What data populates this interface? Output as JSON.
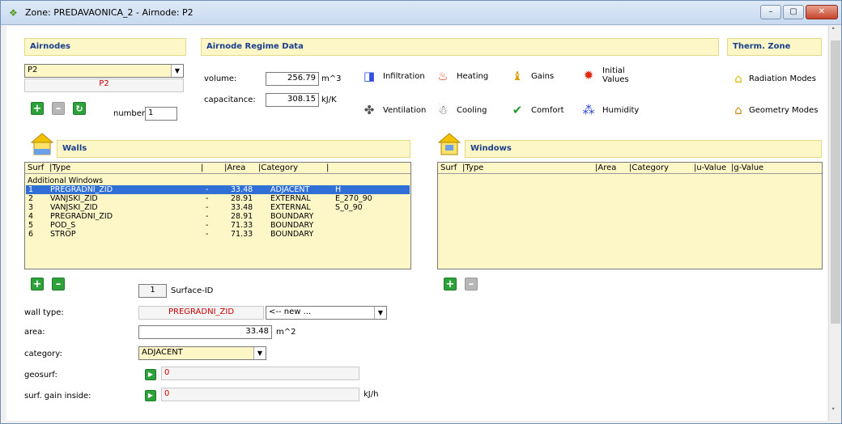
{
  "window": {
    "title": "Zone: PREDAVAONICA_2  -  Airnode: P2",
    "min": "–",
    "max": "▢",
    "close": "✕"
  },
  "airnodes": {
    "header": "Airnodes",
    "selected": "P2",
    "name_display": "P2",
    "number_label": "number:",
    "number_value": "1"
  },
  "regime": {
    "header": "Airnode Regime Data",
    "volume_label": "volume:",
    "volume_value": "256.79",
    "volume_unit": "m^3",
    "capacitance_label": "capacitance:",
    "capacitance_value": "308.15",
    "capacitance_unit": "kJ/K",
    "buttons": [
      "Infiltration",
      "Heating",
      "Gains",
      "Initial Values",
      "Ventilation",
      "Cooling",
      "Comfort",
      "Humidity"
    ]
  },
  "therm": {
    "header": "Therm. Zone",
    "radiation": "Radiation Modes",
    "geometry": "Geometry Modes"
  },
  "walls": {
    "header": "Walls",
    "columns": [
      "Surf",
      "|Type",
      "|",
      "|Area",
      "|Category",
      "|"
    ],
    "group_label": "Additional Windows",
    "rows": [
      {
        "surf": "1",
        "type": "PREGRADNI_ZID",
        "dash": "-",
        "area": "33.48",
        "category": "ADJACENT",
        "extra": "H"
      },
      {
        "surf": "2",
        "type": "VANJSKI_ZID",
        "dash": "-",
        "area": "28.91",
        "category": "EXTERNAL",
        "extra": "E_270_90"
      },
      {
        "surf": "3",
        "type": "VANJSKI_ZID",
        "dash": "-",
        "area": "33.48",
        "category": "EXTERNAL",
        "extra": "S_0_90"
      },
      {
        "surf": "4",
        "type": "PREGRADNI_ZID",
        "dash": "-",
        "area": "28.91",
        "category": "BOUNDARY",
        "extra": ""
      },
      {
        "surf": "5",
        "type": "POD_S",
        "dash": "-",
        "area": "71.33",
        "category": "BOUNDARY",
        "extra": ""
      },
      {
        "surf": "6",
        "type": "STROP",
        "dash": "-",
        "area": "71.33",
        "category": "BOUNDARY",
        "extra": ""
      }
    ]
  },
  "windows": {
    "header": "Windows",
    "columns": [
      "Surf",
      "|Type",
      "|Area",
      "|Category",
      "|u-Value",
      "|g-Value"
    ]
  },
  "detail": {
    "surface_id_value": "1",
    "surface_id_label": "Surface-ID",
    "wall_type_label": "wall type:",
    "wall_type_value": "PREGRADNI_ZID",
    "wall_type_new": "<-- new ...",
    "area_label": "area:",
    "area_value": "33.48",
    "area_unit": "m^2",
    "category_label": "category:",
    "category_value": "ADJACENT",
    "geosurf_label": "geosurf:",
    "geosurf_value": "0",
    "gain_label": "surf. gain inside:",
    "gain_value": "0",
    "gain_unit": "kJ/h"
  }
}
